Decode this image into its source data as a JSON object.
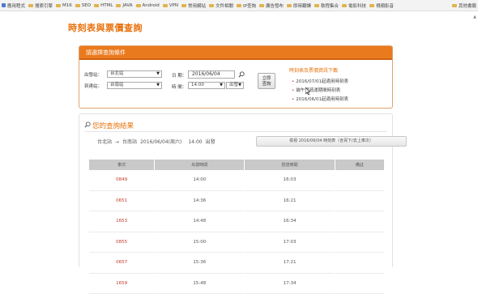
{
  "bookmarks": [
    {
      "label": "應用程式",
      "icon": "apps-icon"
    },
    {
      "label": "搜索引擎",
      "icon": "folder-icon"
    },
    {
      "label": "M16",
      "icon": "folder-icon"
    },
    {
      "label": "SEO",
      "icon": "folder-icon"
    },
    {
      "label": "HTML",
      "icon": "folder-icon"
    },
    {
      "label": "JAVA",
      "icon": "folder-icon"
    },
    {
      "label": "Android",
      "icon": "folder-icon"
    },
    {
      "label": "VPN",
      "icon": "folder-icon"
    },
    {
      "label": "常用網站",
      "icon": "folder-icon"
    },
    {
      "label": "文件相關",
      "icon": "folder-icon"
    },
    {
      "label": "IP查詢",
      "icon": "folder-icon"
    },
    {
      "label": "廣告發布",
      "icon": "folder-icon"
    },
    {
      "label": "即時翻譯",
      "icon": "folder-icon"
    },
    {
      "label": "軟程集合",
      "icon": "folder-icon"
    },
    {
      "label": "電影科技",
      "icon": "folder-icon"
    },
    {
      "label": "視頻影音",
      "icon": "folder-icon"
    }
  ],
  "other_bookmarks": "其他書籤",
  "page": {
    "title": "時刻表與票價查詢"
  },
  "query": {
    "header": "請選擇查詢條件",
    "from_label": "出發站：",
    "from_value": "台北站",
    "to_label": "到達站：",
    "to_value": "台南站",
    "date_label": "日 期：",
    "date_value": "2016/06/04",
    "time_label": "時 間：",
    "time_value": "14:00",
    "direction_value": "出發",
    "submit_line1": "立即",
    "submit_line2": "查詢",
    "download_title": "時刻表及票價資訊下載",
    "download_links": [
      "2016/07/01起適用時刻表",
      "端午節疏運期間時刻表",
      "2016/06/01起適用時刻表"
    ]
  },
  "results": {
    "title": "您的查詢結果",
    "from": "台北站",
    "arrow": "→",
    "to": "台南站",
    "date": "2016/06/04(周六)",
    "time": "14:00",
    "direction": "出發",
    "return_button": "檢視 2016/06/04 時刻表（含買下/去上車次）",
    "columns": [
      "車次",
      "出發時間",
      "抵達時間",
      "備註"
    ],
    "rows": [
      {
        "train": "0849",
        "depart": "14:00",
        "arrive": "16:03",
        "note": ""
      },
      {
        "train": "0651",
        "depart": "14:36",
        "arrive": "16:21",
        "note": ""
      },
      {
        "train": "1653",
        "depart": "14:48",
        "arrive": "16:34",
        "note": ""
      },
      {
        "train": "0855",
        "depart": "15:00",
        "arrive": "17:03",
        "note": ""
      },
      {
        "train": "0657",
        "depart": "15:36",
        "arrive": "17:21",
        "note": ""
      },
      {
        "train": "1659",
        "depart": "15:48",
        "arrive": "17:34",
        "note": ""
      }
    ]
  },
  "colors": {
    "accent": "#ea7a1e",
    "title": "#e8700a",
    "train_number": "#c0392b",
    "header_bg": "#c9c9c9"
  }
}
